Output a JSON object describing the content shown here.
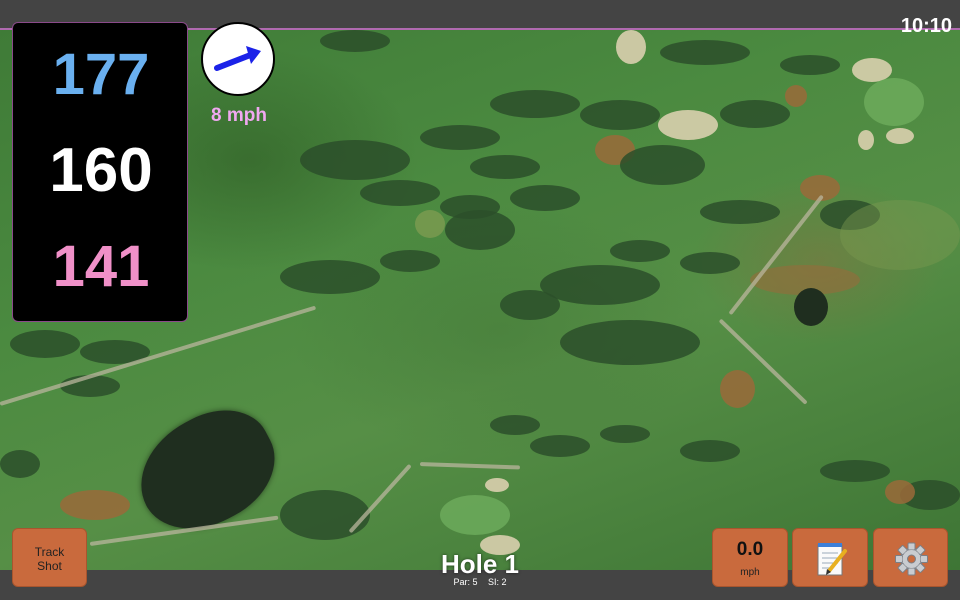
{
  "status": {
    "time": "10:10"
  },
  "distances": {
    "back": "177",
    "middle": "160",
    "front": "141"
  },
  "wind": {
    "speed": "8 mph",
    "icon": "wind-arrow-icon"
  },
  "buttons": {
    "track_shot": {
      "line1": "Track",
      "line2": "Shot"
    },
    "speed": {
      "value": "0.0",
      "unit": "mph"
    },
    "notes": {
      "icon": "notepad-icon"
    },
    "settings": {
      "icon": "gear-icon"
    }
  },
  "hole": {
    "title": "Hole 1",
    "par": "Par: 5",
    "si": "SI: 2"
  },
  "colors": {
    "back_distance": "#6ab0f0",
    "middle_distance": "#ffffff",
    "front_distance": "#f090c8",
    "wind_text": "#f0a8f0",
    "button": "#c96a3d",
    "bar": "#444444"
  }
}
